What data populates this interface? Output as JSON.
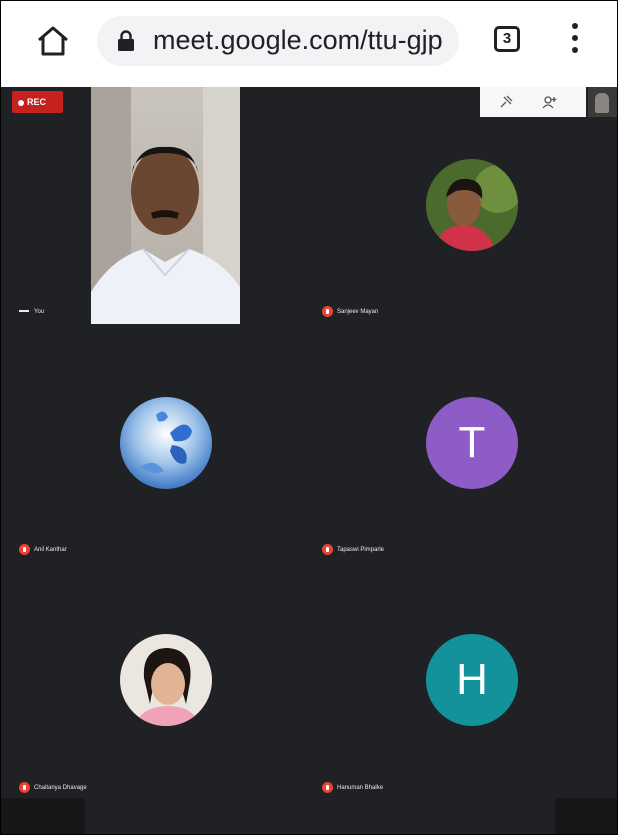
{
  "browser": {
    "url": "meet.google.com/ttu-gjp",
    "tab_count": "3",
    "icons": {
      "home": "home-icon",
      "lock": "lock-icon",
      "menu": "more-vert-icon"
    }
  },
  "meet": {
    "rec_label": "REC",
    "self_label": "You",
    "participants": [
      {
        "name": "Sanjeev Mayan",
        "avatar": "photo"
      },
      {
        "name": "Anil Kanthar",
        "avatar": "butterfly-photo"
      },
      {
        "name": "Tapaswi Pimparle",
        "avatar": "T",
        "color": "#8e5cc7"
      },
      {
        "name": "Chaitanya Dhavage",
        "avatar": "photo"
      },
      {
        "name": "Hanuman Bhalke",
        "avatar": "H",
        "color": "#14929c"
      }
    ],
    "colors": {
      "background": "#202124",
      "rec": "#c5221f",
      "mic_muted": "#ea4335"
    }
  }
}
